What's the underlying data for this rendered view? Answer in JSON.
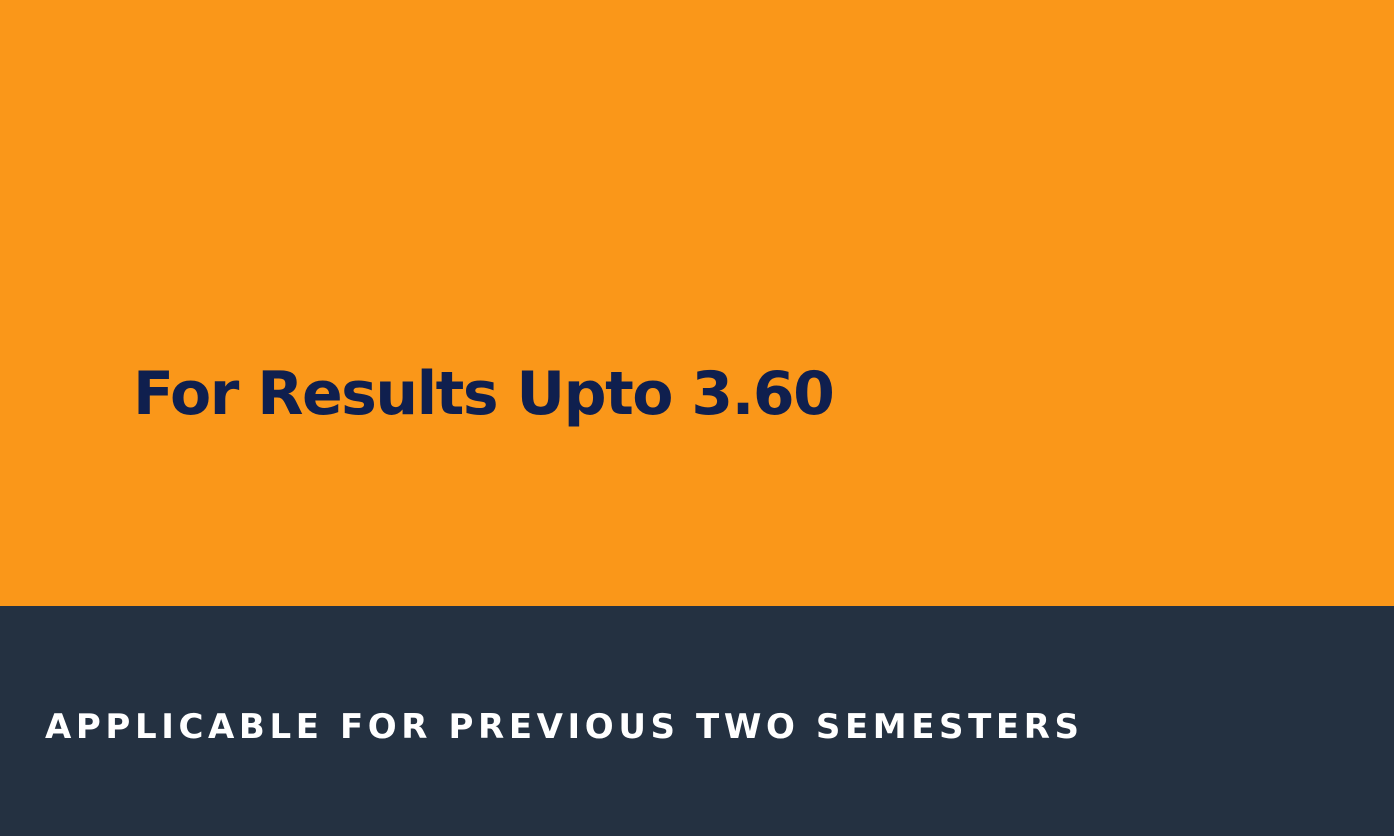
{
  "top_panel": {
    "headline": "For Results Upto 3.60",
    "background_color": "#fa9719",
    "text_color": "#0f1f4e"
  },
  "bottom_panel": {
    "subline": "APPLICABLE FOR PREVIOUS TWO SEMESTERS",
    "background_color": "#243141",
    "text_color": "#ffffff"
  }
}
